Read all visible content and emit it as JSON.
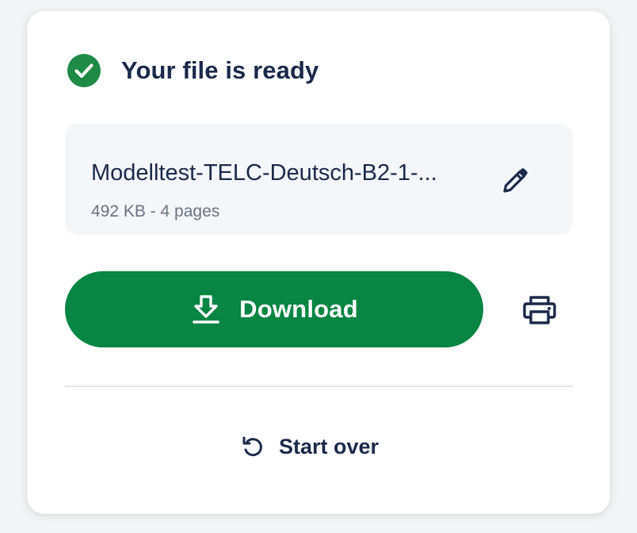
{
  "status": {
    "title": "Your file is ready",
    "icon": "check-circle-icon",
    "color": "#1e8a45"
  },
  "file": {
    "name": "Modelltest-TELC-Deutsch-B2-1-...",
    "meta": "492 KB - 4 pages",
    "edit_icon": "pencil-icon"
  },
  "actions": {
    "download_label": "Download",
    "download_icon": "download-icon",
    "download_color": "#088543",
    "print_icon": "printer-icon",
    "start_over_label": "Start over",
    "start_over_icon": "undo-icon"
  },
  "colors": {
    "text": "#1b2a4a",
    "muted": "#6b7280",
    "panel": "#f4f6f9"
  }
}
